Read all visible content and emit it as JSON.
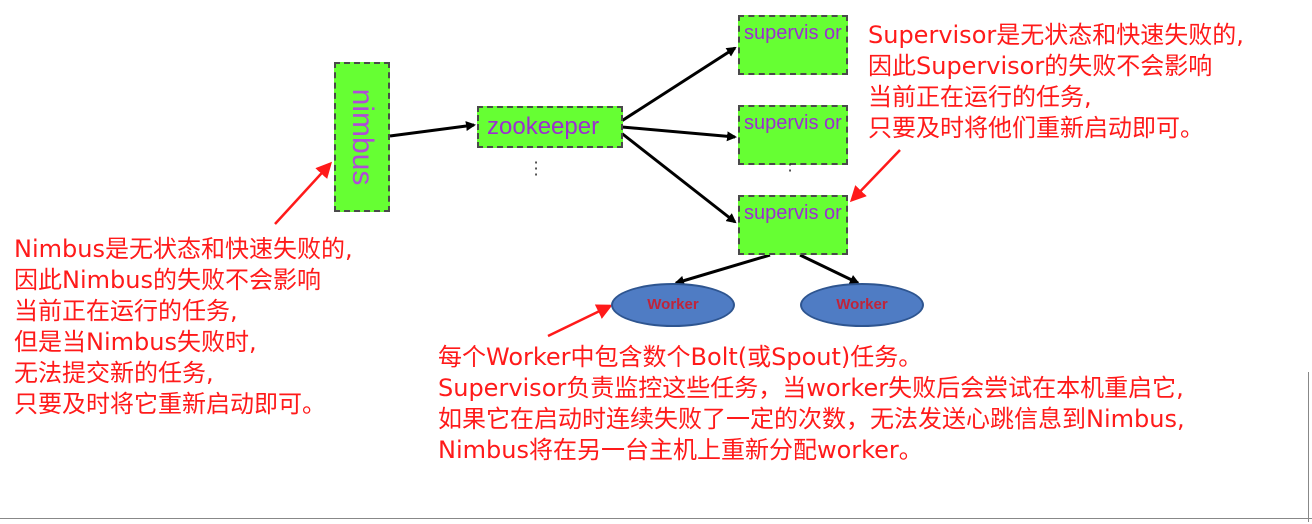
{
  "nodes": {
    "nimbus": "nimbus",
    "zookeeper": "zookeeper",
    "supervisors": [
      "supervis or",
      "supervis or",
      "supervis or"
    ],
    "workers": [
      "Worker",
      "Worker"
    ]
  },
  "notes": {
    "nimbus": [
      "Nimbus是无状态和快速失败的,",
      "因此Nimbus的失败不会影响",
      "当前正在运行的任务,",
      "但是当Nimbus失败时,",
      "无法提交新的任务,",
      "只要及时将它重新启动即可。"
    ],
    "supervisor": [
      "Supervisor是无状态和快速失败的,",
      "因此Supervisor的失败不会影响",
      "当前正在运行的任务,",
      "只要及时将他们重新启动即可。"
    ],
    "worker": [
      "每个Worker中包含数个Bolt(或Spout)任务。",
      "Supervisor负责监控这些任务，当worker失败后会尝试在本机重启它,",
      "如果它在启动时连续失败了一定的次数，无法发送心跳信息到Nimbus,",
      "Nimbus将在另一台主机上重新分配worker。"
    ]
  },
  "colors": {
    "node_fill": "#66ff33",
    "node_text": "#9b2fd0",
    "worker_fill": "#4f7cc4",
    "worker_text": "#c0243a",
    "note_text": "#ff1a1a",
    "arrow_black": "#000000",
    "arrow_red": "#ff1a1a"
  }
}
